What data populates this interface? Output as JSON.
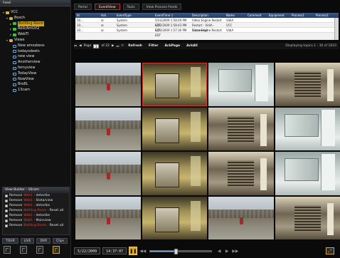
{
  "left_panel": {
    "header": "Feed",
    "tree": [
      {
        "label": "VCC",
        "kind": "folder",
        "indent": 0,
        "expander": "▾"
      },
      {
        "label": "Bosch",
        "kind": "folder",
        "indent": 1,
        "expander": "▾"
      },
      {
        "label": "Bottling Room",
        "kind": "cam",
        "indent": 2,
        "expander": "▸",
        "highlight": true
      },
      {
        "label": "RelicAmUrl2",
        "kind": "cam",
        "indent": 2,
        "expander": "▸"
      },
      {
        "label": "WebTl",
        "kind": "cam",
        "indent": 2,
        "expander": "▸"
      },
      {
        "label": "Views",
        "kind": "folder",
        "indent": 1,
        "expander": "▾"
      },
      {
        "label": "New amosbess",
        "kind": "view",
        "indent": 2,
        "expander": ""
      },
      {
        "label": "todaysdeets",
        "kind": "view",
        "indent": 2,
        "expander": ""
      },
      {
        "label": "new view",
        "kind": "view",
        "indent": 2,
        "expander": ""
      },
      {
        "label": "Anotherview",
        "kind": "view",
        "indent": 2,
        "expander": ""
      },
      {
        "label": "fernyview",
        "kind": "view",
        "indent": 2,
        "expander": ""
      },
      {
        "label": "TodayView",
        "kind": "view",
        "indent": 2,
        "expander": ""
      },
      {
        "label": "NowView",
        "kind": "view",
        "indent": 2,
        "expander": ""
      },
      {
        "label": "Bro8L",
        "kind": "view",
        "indent": 2,
        "expander": ""
      },
      {
        "label": "13cam",
        "kind": "view",
        "indent": 2,
        "expander": ""
      }
    ],
    "view_builder": {
      "header": "View Builder - 16cam",
      "rows": [
        {
          "action": "Remove",
          "cam": "Web1",
          "param": "detectbs"
        },
        {
          "action": "Remove",
          "cam": "Web1",
          "param": "Stata/view"
        },
        {
          "action": "Remove",
          "cam": "Web1",
          "param": "detectbs"
        },
        {
          "action": "Remove",
          "cam": "Bottling Room",
          "param": "Reset uti"
        },
        {
          "action": "Remove",
          "cam": "Web1",
          "param": "detectbs"
        },
        {
          "action": "Remove",
          "cam": "Web1",
          "param": "Mainview"
        },
        {
          "action": "Remove",
          "cam": "Bottling Room",
          "param": "Reset uti"
        }
      ]
    },
    "bottom_buttons": [
      "TOUR",
      "LIVE",
      "DVR",
      "Clips"
    ]
  },
  "tabs": [
    {
      "label": "Portal",
      "active": false
    },
    {
      "label": "EventView",
      "active": true
    },
    {
      "label": "Tools",
      "active": false
    },
    {
      "label": "View Process Feeds",
      "active": false
    }
  ],
  "event_table": {
    "columns": [
      "Id",
      "",
      "Ack",
      "EventType",
      "EventTime ▽",
      "Description",
      "Name",
      "Comment",
      "Equipment",
      "Process1",
      "Process2"
    ],
    "rows": [
      [
        "10...",
        "",
        "☒",
        "System",
        "5/22/2009 1:58:49 PM EDT",
        "Video Engine Restart",
        "VidiA",
        "",
        "",
        "",
        ""
      ],
      [
        "10...",
        "",
        "☒",
        "System",
        "5/22/2009 1:58:43 PM EDT",
        "Restart - VidiA - Succeeded",
        "VCC",
        "",
        "",
        "",
        ""
      ],
      [
        "10...",
        "",
        "☒",
        "System",
        "5/22/2009 1:57:30 PM EDT",
        "Video Engine Restart",
        "VidiA",
        "",
        "",
        "",
        ""
      ]
    ]
  },
  "nav": {
    "page_label": "Page",
    "page_value": "1",
    "of_label": "of 22",
    "buttons": [
      "Refresh",
      "Filter",
      "AckPage",
      "AckAll"
    ],
    "displaying": "Displaying topics 1 - 30 of 1610"
  },
  "grid": {
    "cells": [
      "fy",
      "lab",
      "room",
      "mach",
      "fy",
      "lab",
      "mach",
      "room",
      "fy",
      "lab",
      "mach",
      "room",
      "fy",
      "lab",
      "fy",
      "mach"
    ],
    "selected_index": 1
  },
  "transport": {
    "date": "5/22/2009",
    "time": "14:37:07",
    "pause_glyph": "❚❚",
    "progress": 0.42,
    "fullscreen_glyph": "⤢"
  }
}
